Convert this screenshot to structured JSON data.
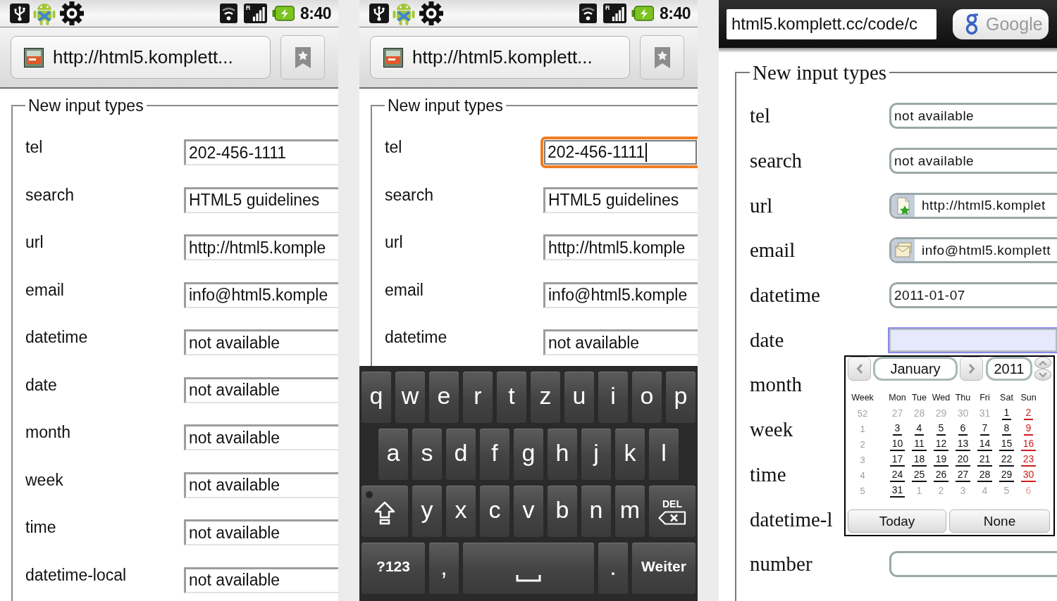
{
  "screens": [
    {
      "status_bar": {
        "roaming": "R",
        "time": "8:40"
      },
      "address_bar": {
        "url": "http://html5.komplett..."
      },
      "form": {
        "legend": "New input types",
        "rows": [
          {
            "label": "tel",
            "value": "202-456-1111",
            "focused": false
          },
          {
            "label": "search",
            "value": "HTML5 guidelines",
            "focused": false
          },
          {
            "label": "url",
            "value": "http://html5.komple",
            "focused": false
          },
          {
            "label": "email",
            "value": "info@html5.komple",
            "focused": false
          },
          {
            "label": "datetime",
            "value": "not available",
            "focused": false
          },
          {
            "label": "date",
            "value": "not available",
            "focused": false
          },
          {
            "label": "month",
            "value": "not available",
            "focused": false
          },
          {
            "label": "week",
            "value": "not available",
            "focused": false
          },
          {
            "label": "time",
            "value": "not available",
            "focused": false
          },
          {
            "label": "datetime-local",
            "value": "not available",
            "focused": false
          }
        ]
      }
    },
    {
      "status_bar": {
        "roaming": "R",
        "time": "8:40"
      },
      "address_bar": {
        "url": "http://html5.komplett..."
      },
      "form": {
        "legend": "New input types",
        "rows": [
          {
            "label": "tel",
            "value": "202-456-1111",
            "focused": true
          },
          {
            "label": "search",
            "value": "HTML5 guidelines",
            "focused": false
          },
          {
            "label": "url",
            "value": "http://html5.komple",
            "focused": false
          },
          {
            "label": "email",
            "value": "info@html5.komple",
            "focused": false
          },
          {
            "label": "datetime",
            "value": "not available",
            "focused": false
          }
        ]
      },
      "keyboard": {
        "rows": [
          {
            "keys": [
              {
                "kind": "letter",
                "label": "q"
              },
              {
                "kind": "letter",
                "label": "w"
              },
              {
                "kind": "letter",
                "label": "e"
              },
              {
                "kind": "letter",
                "label": "r"
              },
              {
                "kind": "letter",
                "label": "t"
              },
              {
                "kind": "letter",
                "label": "z"
              },
              {
                "kind": "letter",
                "label": "u"
              },
              {
                "kind": "letter",
                "label": "i"
              },
              {
                "kind": "letter",
                "label": "o"
              },
              {
                "kind": "letter",
                "label": "p"
              }
            ]
          },
          {
            "keys": [
              {
                "kind": "letter",
                "label": "a"
              },
              {
                "kind": "letter",
                "label": "s"
              },
              {
                "kind": "letter",
                "label": "d"
              },
              {
                "kind": "letter",
                "label": "f"
              },
              {
                "kind": "letter",
                "label": "g"
              },
              {
                "kind": "letter",
                "label": "h"
              },
              {
                "kind": "letter",
                "label": "j"
              },
              {
                "kind": "letter",
                "label": "k"
              },
              {
                "kind": "letter",
                "label": "l"
              }
            ]
          },
          {
            "keys": [
              {
                "kind": "shift"
              },
              {
                "kind": "letter",
                "label": "y"
              },
              {
                "kind": "letter",
                "label": "x"
              },
              {
                "kind": "letter",
                "label": "c"
              },
              {
                "kind": "letter",
                "label": "v"
              },
              {
                "kind": "letter",
                "label": "b"
              },
              {
                "kind": "letter",
                "label": "n"
              },
              {
                "kind": "letter",
                "label": "m"
              },
              {
                "kind": "delete",
                "label": "DEL"
              }
            ]
          },
          {
            "keys": [
              {
                "kind": "wide",
                "label": "?123"
              },
              {
                "kind": "letter",
                "label": ","
              },
              {
                "kind": "space"
              },
              {
                "kind": "letter",
                "label": "."
              },
              {
                "kind": "wide",
                "label": "Weiter"
              }
            ]
          }
        ]
      }
    },
    {
      "toolbar": {
        "url": "html5.komplett.cc/code/c",
        "search_button": "Google"
      },
      "form": {
        "legend": "New input types",
        "rows": [
          {
            "label": "tel",
            "kind": "text",
            "value": "not available",
            "focused": false
          },
          {
            "label": "search",
            "kind": "text",
            "value": "not available",
            "focused": false
          },
          {
            "label": "url",
            "kind": "url",
            "value": "http://html5.komplet",
            "focused": false
          },
          {
            "label": "email",
            "kind": "email",
            "value": "info@html5.komplett",
            "focused": false
          },
          {
            "label": "datetime",
            "kind": "text",
            "value": "2011-01-07",
            "focused": false
          },
          {
            "label": "date",
            "kind": "text",
            "focused": true
          },
          {
            "label": "month",
            "kind": "covered"
          },
          {
            "label": "week",
            "kind": "covered"
          },
          {
            "label": "time",
            "kind": "covered"
          },
          {
            "label": "datetime-l",
            "kind": "covered"
          },
          {
            "label": "number",
            "kind": "text",
            "focused": false
          }
        ]
      },
      "calendar": {
        "month": "January",
        "year": "2011",
        "headers": [
          "Week",
          "Mon",
          "Tue",
          "Wed",
          "Thu",
          "Fri",
          "Sat",
          "Sun"
        ],
        "weeks": [
          {
            "number": "52",
            "days": [
              {
                "day": "27",
                "in_month": false
              },
              {
                "day": "28",
                "in_month": false
              },
              {
                "day": "29",
                "in_month": false
              },
              {
                "day": "30",
                "in_month": false
              },
              {
                "day": "31",
                "in_month": false
              },
              {
                "day": "1",
                "in_month": true
              },
              {
                "day": "2",
                "in_month": true
              }
            ]
          },
          {
            "number": "1",
            "days": [
              {
                "day": "3",
                "in_month": true
              },
              {
                "day": "4",
                "in_month": true
              },
              {
                "day": "5",
                "in_month": true
              },
              {
                "day": "6",
                "in_month": true
              },
              {
                "day": "7",
                "in_month": true
              },
              {
                "day": "8",
                "in_month": true
              },
              {
                "day": "9",
                "in_month": true
              }
            ]
          },
          {
            "number": "2",
            "days": [
              {
                "day": "10",
                "in_month": true
              },
              {
                "day": "11",
                "in_month": true
              },
              {
                "day": "12",
                "in_month": true
              },
              {
                "day": "13",
                "in_month": true
              },
              {
                "day": "14",
                "in_month": true
              },
              {
                "day": "15",
                "in_month": true
              },
              {
                "day": "16",
                "in_month": true
              }
            ]
          },
          {
            "number": "3",
            "days": [
              {
                "day": "17",
                "in_month": true
              },
              {
                "day": "18",
                "in_month": true
              },
              {
                "day": "19",
                "in_month": true
              },
              {
                "day": "20",
                "in_month": true
              },
              {
                "day": "21",
                "in_month": true
              },
              {
                "day": "22",
                "in_month": true
              },
              {
                "day": "23",
                "in_month": true
              }
            ]
          },
          {
            "number": "4",
            "days": [
              {
                "day": "24",
                "in_month": true
              },
              {
                "day": "25",
                "in_month": true
              },
              {
                "day": "26",
                "in_month": true
              },
              {
                "day": "27",
                "in_month": true
              },
              {
                "day": "28",
                "in_month": true
              },
              {
                "day": "29",
                "in_month": true
              },
              {
                "day": "30",
                "in_month": true
              }
            ]
          },
          {
            "number": "5",
            "days": [
              {
                "day": "31",
                "in_month": true
              },
              {
                "day": "1",
                "in_month": false
              },
              {
                "day": "2",
                "in_month": false
              },
              {
                "day": "3",
                "in_month": false
              },
              {
                "day": "4",
                "in_month": false
              },
              {
                "day": "5",
                "in_month": false
              },
              {
                "day": "6",
                "in_month": false
              }
            ]
          }
        ],
        "buttons": [
          "Today",
          "None"
        ]
      }
    }
  ]
}
